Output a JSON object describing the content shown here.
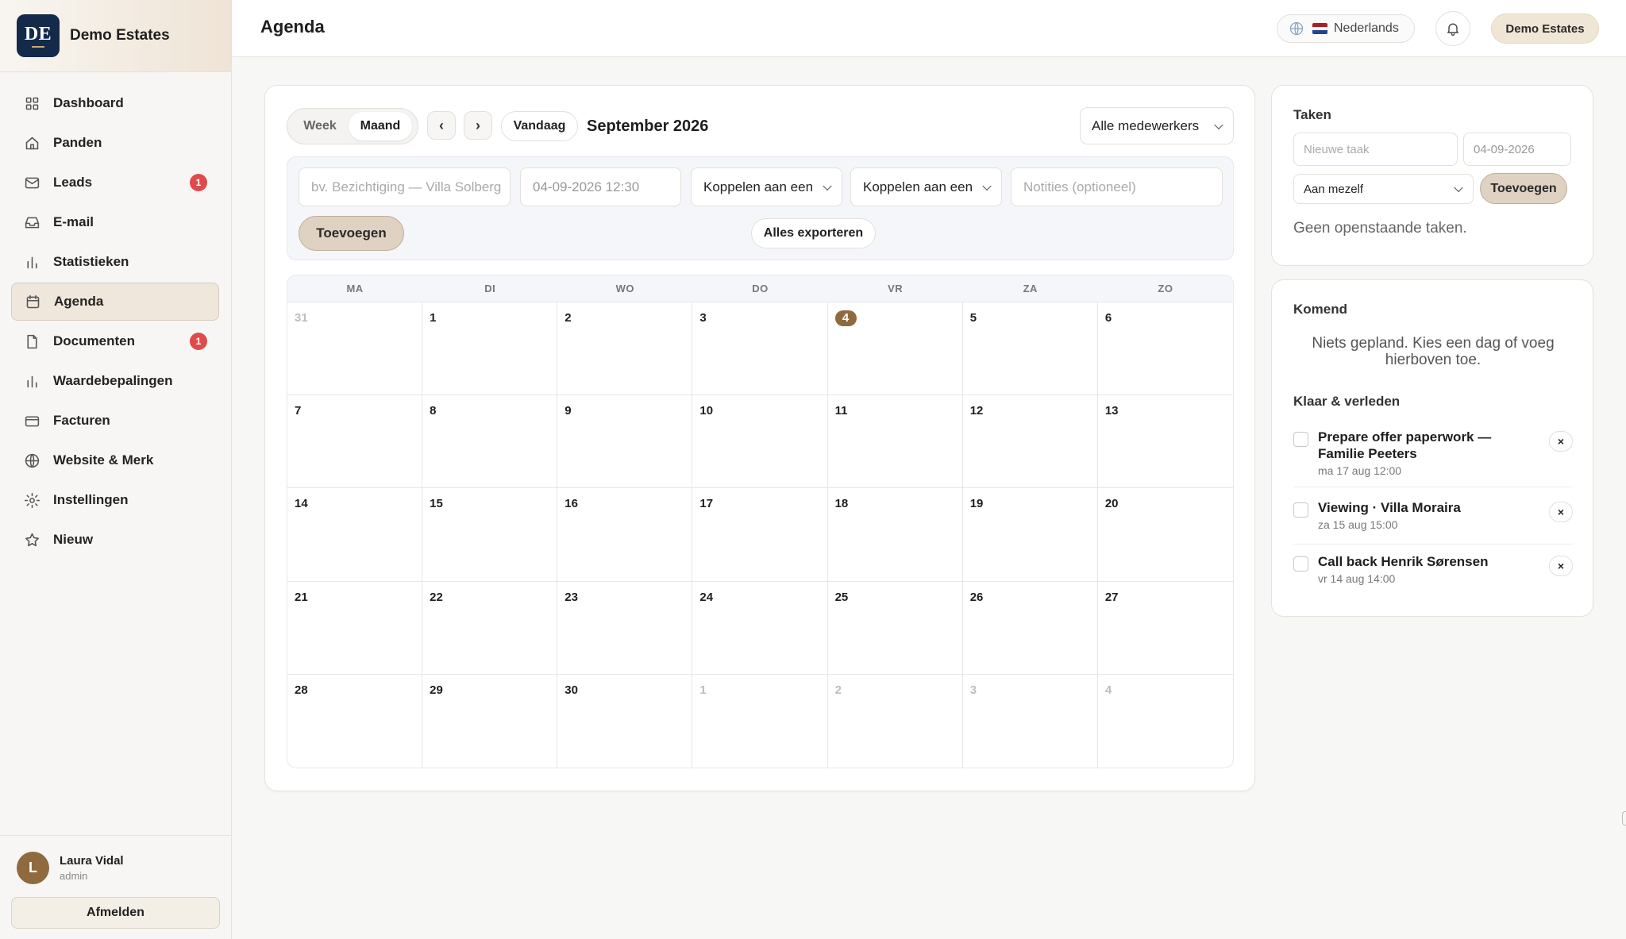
{
  "brand": {
    "logo_text": "DE",
    "name": "Demo Estates"
  },
  "nav": [
    {
      "label": "Dashboard",
      "icon": "grid-icon"
    },
    {
      "label": "Panden",
      "icon": "home-icon"
    },
    {
      "label": "Leads",
      "icon": "mail-icon",
      "badge": "1"
    },
    {
      "label": "E-mail",
      "icon": "inbox-icon"
    },
    {
      "label": "Statistieken",
      "icon": "bar-chart-icon"
    },
    {
      "label": "Agenda",
      "icon": "calendar-icon",
      "active": true
    },
    {
      "label": "Documenten",
      "icon": "document-icon",
      "badge": "1"
    },
    {
      "label": "Waardebepalingen",
      "icon": "bar-chart-icon"
    },
    {
      "label": "Facturen",
      "icon": "credit-card-icon"
    },
    {
      "label": "Website & Merk",
      "icon": "globe-icon"
    },
    {
      "label": "Instellingen",
      "icon": "gear-icon"
    },
    {
      "label": "Nieuw",
      "icon": "star-icon"
    }
  ],
  "user": {
    "initial": "L",
    "name": "Laura Vidal",
    "role": "admin"
  },
  "logout_label": "Afmelden",
  "topbar": {
    "title": "Agenda",
    "language": "Nederlands",
    "org": "Demo Estates"
  },
  "calendar": {
    "view_week": "Week",
    "view_month": "Maand",
    "prev": "‹",
    "next": "›",
    "today_label": "Vandaag",
    "month_title": "September 2026",
    "staff_filter": "Alle medewerkers",
    "form": {
      "title_placeholder": "bv. Bezichtiging — Villa Solberg",
      "datetime_value": "04-09-2026 12:30",
      "link1": "Koppelen aan een",
      "link2": "Koppelen aan een",
      "notes_placeholder": "Notities (optioneel)",
      "add_label": "Toevoegen",
      "export_label": "Alles exporteren"
    },
    "weekdays": [
      "MA",
      "DI",
      "WO",
      "DO",
      "VR",
      "ZA",
      "ZO"
    ],
    "weeks": [
      [
        {
          "d": "31",
          "m": true
        },
        {
          "d": "1"
        },
        {
          "d": "2"
        },
        {
          "d": "3"
        },
        {
          "d": "4",
          "today": true
        },
        {
          "d": "5"
        },
        {
          "d": "6"
        }
      ],
      [
        {
          "d": "7"
        },
        {
          "d": "8"
        },
        {
          "d": "9"
        },
        {
          "d": "10"
        },
        {
          "d": "11"
        },
        {
          "d": "12"
        },
        {
          "d": "13"
        }
      ],
      [
        {
          "d": "14"
        },
        {
          "d": "15"
        },
        {
          "d": "16"
        },
        {
          "d": "17"
        },
        {
          "d": "18"
        },
        {
          "d": "19"
        },
        {
          "d": "20"
        }
      ],
      [
        {
          "d": "21"
        },
        {
          "d": "22"
        },
        {
          "d": "23"
        },
        {
          "d": "24"
        },
        {
          "d": "25"
        },
        {
          "d": "26"
        },
        {
          "d": "27"
        }
      ],
      [
        {
          "d": "28"
        },
        {
          "d": "29"
        },
        {
          "d": "30"
        },
        {
          "d": "1",
          "m": true
        },
        {
          "d": "2",
          "m": true
        },
        {
          "d": "3",
          "m": true
        },
        {
          "d": "4",
          "m": true
        }
      ]
    ]
  },
  "tasks": {
    "title": "Taken",
    "new_placeholder": "Nieuwe taak",
    "date_value": "04-09-2026",
    "assign": "Aan mezelf",
    "add_label": "Toevoegen",
    "empty": "Geen openstaande taken."
  },
  "upcoming": {
    "title": "Komend",
    "empty": "Niets gepland. Kies een dag of voeg hierboven toe.",
    "past_title": "Klaar & verleden",
    "items": [
      {
        "title": "Prepare offer paperwork — Familie Peeters",
        "time": "ma 17 aug 12:00"
      },
      {
        "title": "Viewing · Villa Moraira",
        "time": "za 15 aug 15:00"
      },
      {
        "title": "Call back Henrik Sørensen",
        "time": "vr 14 aug 14:00"
      }
    ],
    "remove_label": "×"
  },
  "colors": {
    "accent": "#8e6a3e",
    "brand_dark": "#142a4a",
    "badge": "#e04a4a",
    "button_fill": "#dfd2c2"
  }
}
